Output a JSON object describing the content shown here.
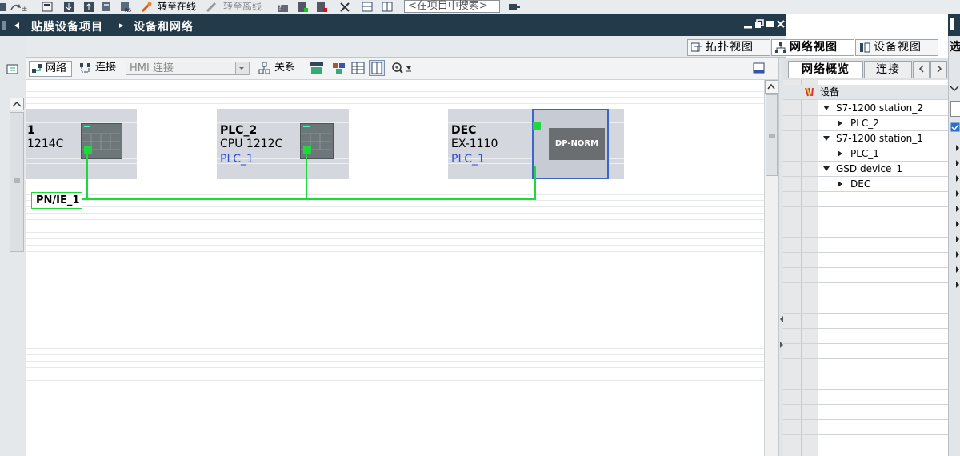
{
  "toolbar": {
    "go_online": "转至在线",
    "go_offline": "转至离线",
    "search_placeholder": "<在项目中搜索>"
  },
  "titlebar": {
    "project": "贴膜设备项目",
    "separator": "▸",
    "section": "设备和网络"
  },
  "view_tabs": [
    {
      "label": "拓扑视图",
      "active": false
    },
    {
      "label": "网络视图",
      "active": true
    },
    {
      "label": "设备视图",
      "active": false
    }
  ],
  "editor_toolbar": {
    "network": "网络",
    "connection": "连接",
    "hmi_connection": "HMI 连接",
    "relations": "关系"
  },
  "devices": [
    {
      "name": "1",
      "type": "1214C",
      "link": ""
    },
    {
      "name": "PLC_2",
      "type": "CPU 1212C",
      "link": "PLC_1"
    },
    {
      "name": "DEC",
      "type": "EX-1110",
      "link": "PLC_1",
      "module_label": "DP-NORM"
    }
  ],
  "network": {
    "label": "PN/IE_1",
    "color": "#1fd83b"
  },
  "right_panel": {
    "tabs": [
      {
        "label": "网络概览",
        "active": true
      },
      {
        "label": "连接",
        "active": false
      }
    ],
    "header": "设备",
    "tree": [
      {
        "label": "S7-1200 station_2",
        "level": 0,
        "expanded": true
      },
      {
        "label": "PLC_2",
        "level": 1,
        "expanded": false
      },
      {
        "label": "S7-1200 station_1",
        "level": 0,
        "expanded": true
      },
      {
        "label": "PLC_1",
        "level": 1,
        "expanded": false
      },
      {
        "label": "GSD device_1",
        "level": 0,
        "expanded": true
      },
      {
        "label": "DEC",
        "level": 1,
        "expanded": false
      }
    ]
  },
  "far_right": {
    "label": "选"
  },
  "colors": {
    "titlebar_bg": "#233a4b",
    "device_bg": "#d4d7dd",
    "link_blue": "#2d4bdd",
    "selection_border": "#3a66cc"
  }
}
